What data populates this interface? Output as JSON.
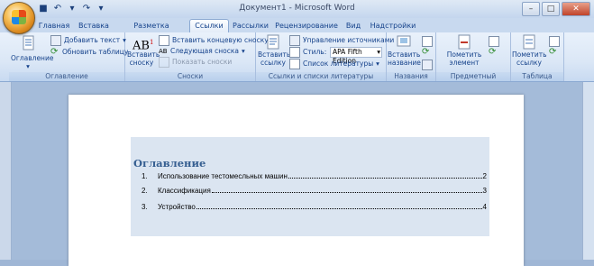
{
  "window": {
    "title": "Документ1 - Microsoft Word"
  },
  "tabs": [
    "Главная",
    "Вставка",
    "Разметка страницы",
    "Ссылки",
    "Рассылки",
    "Рецензирование",
    "Вид",
    "Надстройки"
  ],
  "active_tab": "Ссылки",
  "ribbon": {
    "toc": {
      "label": "Оглавление",
      "big": "Оглавление",
      "add_text": "Добавить текст",
      "update": "Обновить таблицу"
    },
    "footnotes": {
      "label": "Сноски",
      "insert_line1": "Вставить",
      "insert_line2": "сноску",
      "endnote": "Вставить концевую сноску",
      "next": "Следующая сноска",
      "show": "Показать сноски"
    },
    "citations": {
      "label": "Ссылки и списки литературы",
      "insert_line1": "Вставить",
      "insert_line2": "ссылку",
      "manage": "Управление источниками",
      "style_label": "Стиль:",
      "style_value": "APA Fifth Edition",
      "biblio": "Список литературы"
    },
    "captions": {
      "label": "Названия",
      "insert_line1": "Вставить",
      "insert_line2": "название"
    },
    "index": {
      "label": "Предметный указатель",
      "mark_line1": "Пометить",
      "mark_line2": "элемент"
    },
    "toa": {
      "label": "Таблица ссылок",
      "mark_line1": "Пометить",
      "mark_line2": "ссылку"
    }
  },
  "document": {
    "toc_title": "Оглавление",
    "entries": [
      {
        "num": "1.",
        "text": "Использование тестомесльных машин",
        "page": "2"
      },
      {
        "num": "2.",
        "text": "Классификация",
        "page": "3"
      },
      {
        "num": "3.",
        "text": "Устройство",
        "page": "4"
      }
    ]
  }
}
